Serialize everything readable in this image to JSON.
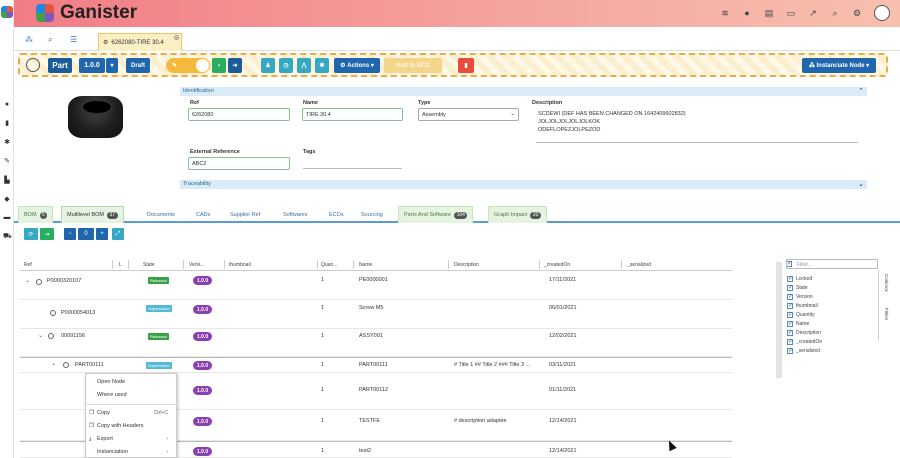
{
  "app": {
    "name": "Ganister"
  },
  "open_tab": {
    "label": "6262080-TIRE 30.4"
  },
  "toolbar": {
    "type_label": "Part",
    "version": "1.0.0",
    "status": "Draft",
    "actions_label": "Actions",
    "add_to_eco_label": "Add to ECO",
    "instantiate_label": "Instanciate Node"
  },
  "identification": {
    "section_title": "Identification",
    "ref_label": "Ref",
    "ref_value": "6262080",
    "name_label": "Name",
    "name_value": "TIRE 30.4",
    "type_label": "Type",
    "type_value": "Assembly",
    "description_label": "Description",
    "description_lines": [
      "SCDEWI (DEF HAS BEEN CHANGED ON 1642409602832)",
      "JOLJOLJOLJOLJOLKOK",
      "ODEFLOPEZJOLPEZOD"
    ],
    "external_ref_label": "External Reference",
    "external_ref_value": "ABC2",
    "tags_label": "Tags"
  },
  "traceability": {
    "section_title": "Traceability"
  },
  "subtabs": [
    {
      "label": "BOM",
      "badge": "5"
    },
    {
      "label": "Multilevel BOM",
      "badge": "37"
    },
    {
      "label": "Documents"
    },
    {
      "label": "CADs"
    },
    {
      "label": "Supplier Ref"
    },
    {
      "label": "Softwares"
    },
    {
      "label": "ECOs"
    },
    {
      "label": "Sourcing"
    },
    {
      "label": "Parts And Software",
      "badge": "104"
    },
    {
      "label": "Graph Impact",
      "badge": "20"
    }
  ],
  "bom_controls": {
    "level_value": "0"
  },
  "grid": {
    "columns": [
      "Ref",
      "L",
      "State",
      "Versi...",
      "thumbnail",
      "Quan...",
      "Name",
      "Description",
      "_createdOn",
      "_serialized"
    ],
    "rows": [
      {
        "ref": "P0000320107",
        "state": "Released",
        "version": "1.0.0",
        "qty": "1",
        "name": "PE0000001",
        "description": "",
        "created": "17/11/2021"
      },
      {
        "ref": "P0000054013",
        "state": "Superseded",
        "version": "1.0.0",
        "qty": "1",
        "name": "Screw M5",
        "description": "",
        "created": "06/01/2021"
      },
      {
        "ref": "00091156",
        "state": "Released",
        "version": "1.0.0",
        "qty": "1",
        "name": "ASSY001",
        "description": "",
        "created": "12/02/2021"
      },
      {
        "ref": "PART00111",
        "state": "Superseded",
        "version": "1.0.0",
        "qty": "1",
        "name": "PART00111",
        "description": "# Title 1 ## Title 2 ### Title 3 ...",
        "created": "03/11/2021"
      },
      {
        "ref": "",
        "state": "",
        "version": "1.0.0",
        "qty": "1",
        "name": "PART00112",
        "description": "",
        "created": "01/11/2021"
      },
      {
        "ref": "",
        "state": "",
        "version": "1.0.0",
        "qty": "1",
        "name": "TESTFE",
        "description": "# description adaptée",
        "created": "12/14/2021"
      },
      {
        "ref": "",
        "state": "",
        "version": "1.0.0",
        "qty": "1",
        "name": "test2",
        "description": "",
        "created": "12/14/2021"
      }
    ]
  },
  "context_menu": {
    "items": [
      {
        "label": "Open Node"
      },
      {
        "label": "Where used"
      },
      {
        "label": "Copy",
        "shortcut": "Ctrl+C"
      },
      {
        "label": "Copy with Headers"
      },
      {
        "label": "Export"
      },
      {
        "label": "Instanciation"
      }
    ]
  },
  "column_panel": {
    "filter_placeholder": "Filter...",
    "items": [
      "Locked",
      "State",
      "Version",
      "thumbnail",
      "Quantity",
      "Name",
      "Description",
      "_createdOn",
      "_serialized"
    ],
    "side_tabs": [
      "Columns",
      "Filters"
    ]
  }
}
